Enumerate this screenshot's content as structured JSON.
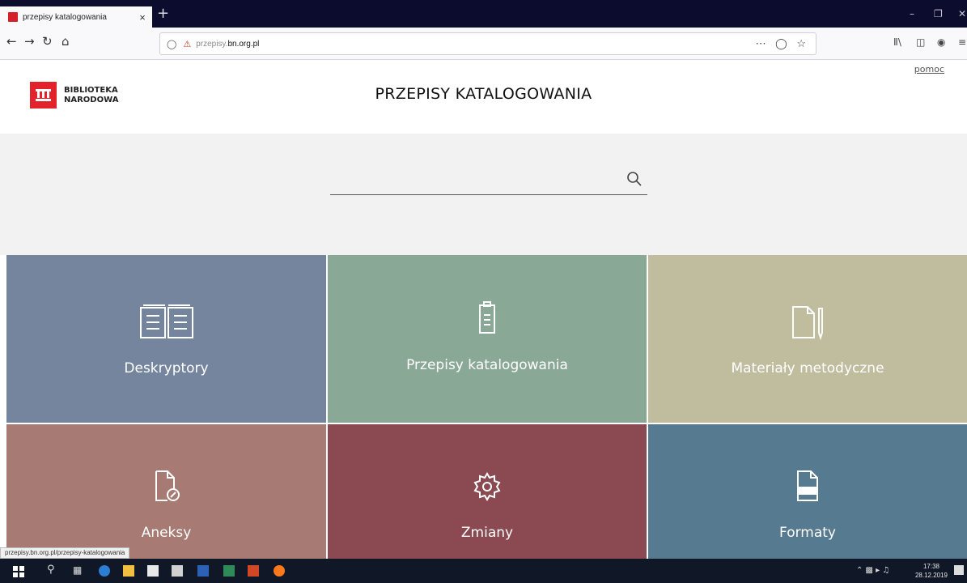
{
  "browser": {
    "tab_title": "przepisy katalogowania",
    "tab_close": "×",
    "new_tab": "+",
    "url_prefix": "przepisy.",
    "url_domain": "bn.org.pl",
    "status_url": "przepisy.bn.org.pl/przepisy-katalogowania"
  },
  "header": {
    "logo_line1": "BIBLIOTEKA",
    "logo_line2": "NARODOWA",
    "title": "PRZEPISY KATALOGOWANIA",
    "help_link": "pomoc"
  },
  "search": {
    "placeholder": "",
    "value": ""
  },
  "tiles": [
    {
      "label": "Deskryptory",
      "icon": "book-icon",
      "color": "#75859e"
    },
    {
      "label": "Przepisy katalogowania",
      "icon": "clipboard-icon",
      "color": "#8aa896"
    },
    {
      "label": "Materiały metodyczne",
      "icon": "note-pen-icon",
      "color": "#bfbd9e"
    },
    {
      "label": "Aneksy",
      "icon": "document-clip-icon",
      "color": "#a77a73"
    },
    {
      "label": "Zmiany",
      "icon": "gear-icon",
      "color": "#8b4a52"
    },
    {
      "label": "Formaty",
      "icon": "file-format-icon",
      "color": "#567a8f"
    }
  ],
  "taskbar": {
    "time": "17:38",
    "date": "28.12.2019"
  },
  "colors": {
    "brand_red": "#e3232c",
    "tab_bar": "#0c0c2e",
    "taskbar": "#101828"
  }
}
